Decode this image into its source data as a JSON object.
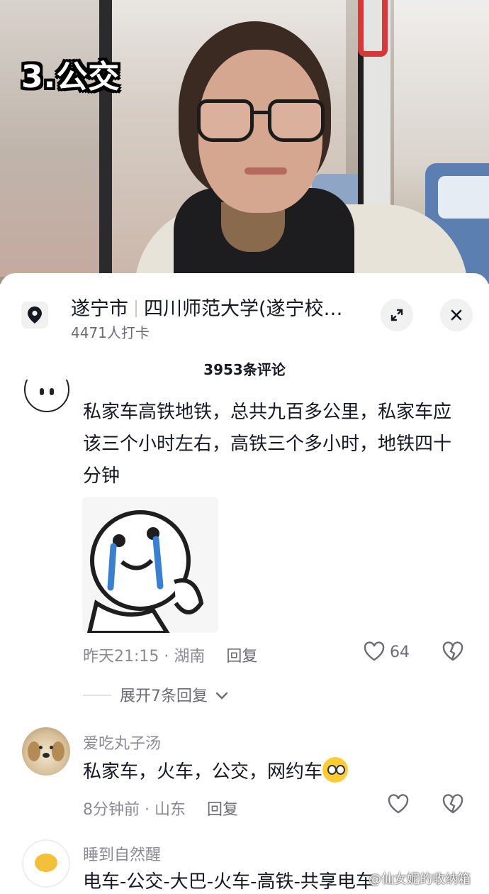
{
  "video": {
    "overlay_title": "3.公交"
  },
  "location": {
    "city": "遂宁市",
    "place": "四川师范大学(遂宁校…",
    "checkins": "4471人打卡"
  },
  "comments_header": {
    "count": "3953条评论"
  },
  "comments": [
    {
      "text": "私家车高铁地铁，总共九百多公里，私家车应该三个小时左右，高铁三个多小时，地铁四十分钟",
      "time_location": "昨天21:15 · 湖南",
      "reply_label": "回复",
      "likes": "64",
      "expand_replies": "展开7条回复"
    },
    {
      "username": "爱吃丸子汤",
      "text": "私家车，火车，公交，网约车",
      "time_location": "8分钟前 · 山东",
      "reply_label": "回复"
    },
    {
      "username": "睡到自然醒",
      "text": "电车-公交-大巴-火车-高铁-共享电车"
    }
  ],
  "watermark": "@仙女妮的收纳箱",
  "icons": {
    "location": "pin-icon",
    "expand": "expand-icon",
    "close": "close-icon",
    "like": "heart-icon",
    "dislike": "broken-heart-icon",
    "chevron": "chevron-down-icon"
  }
}
